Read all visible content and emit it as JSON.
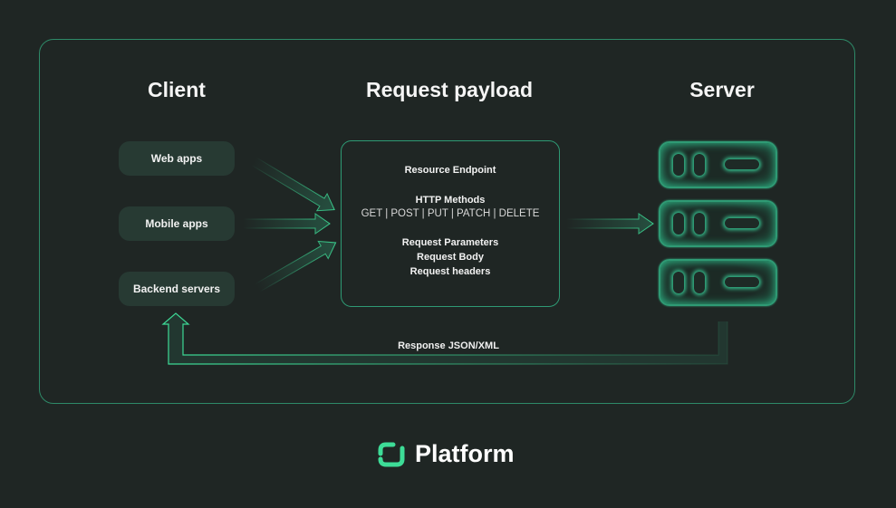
{
  "columns": {
    "client": "Client",
    "payload": "Request payload",
    "server": "Server"
  },
  "clients": [
    {
      "label": "Web apps"
    },
    {
      "label": "Mobile apps"
    },
    {
      "label": "Backend servers"
    }
  ],
  "payload": {
    "endpoint": "Resource Endpoint",
    "methods_title": "HTTP Methods",
    "methods_list": "GET | POST | PUT | PATCH | DELETE",
    "params": "Request Parameters",
    "body": "Request Body",
    "headers": "Request headers"
  },
  "servers_count": 3,
  "response_label": "Response JSON/XML",
  "brand": {
    "name": "Platform",
    "icon": "platform-logo-icon"
  },
  "colors": {
    "accent": "#3ddc97",
    "background": "#1f2624",
    "pill": "#273a33",
    "border": "#2e8a68"
  }
}
